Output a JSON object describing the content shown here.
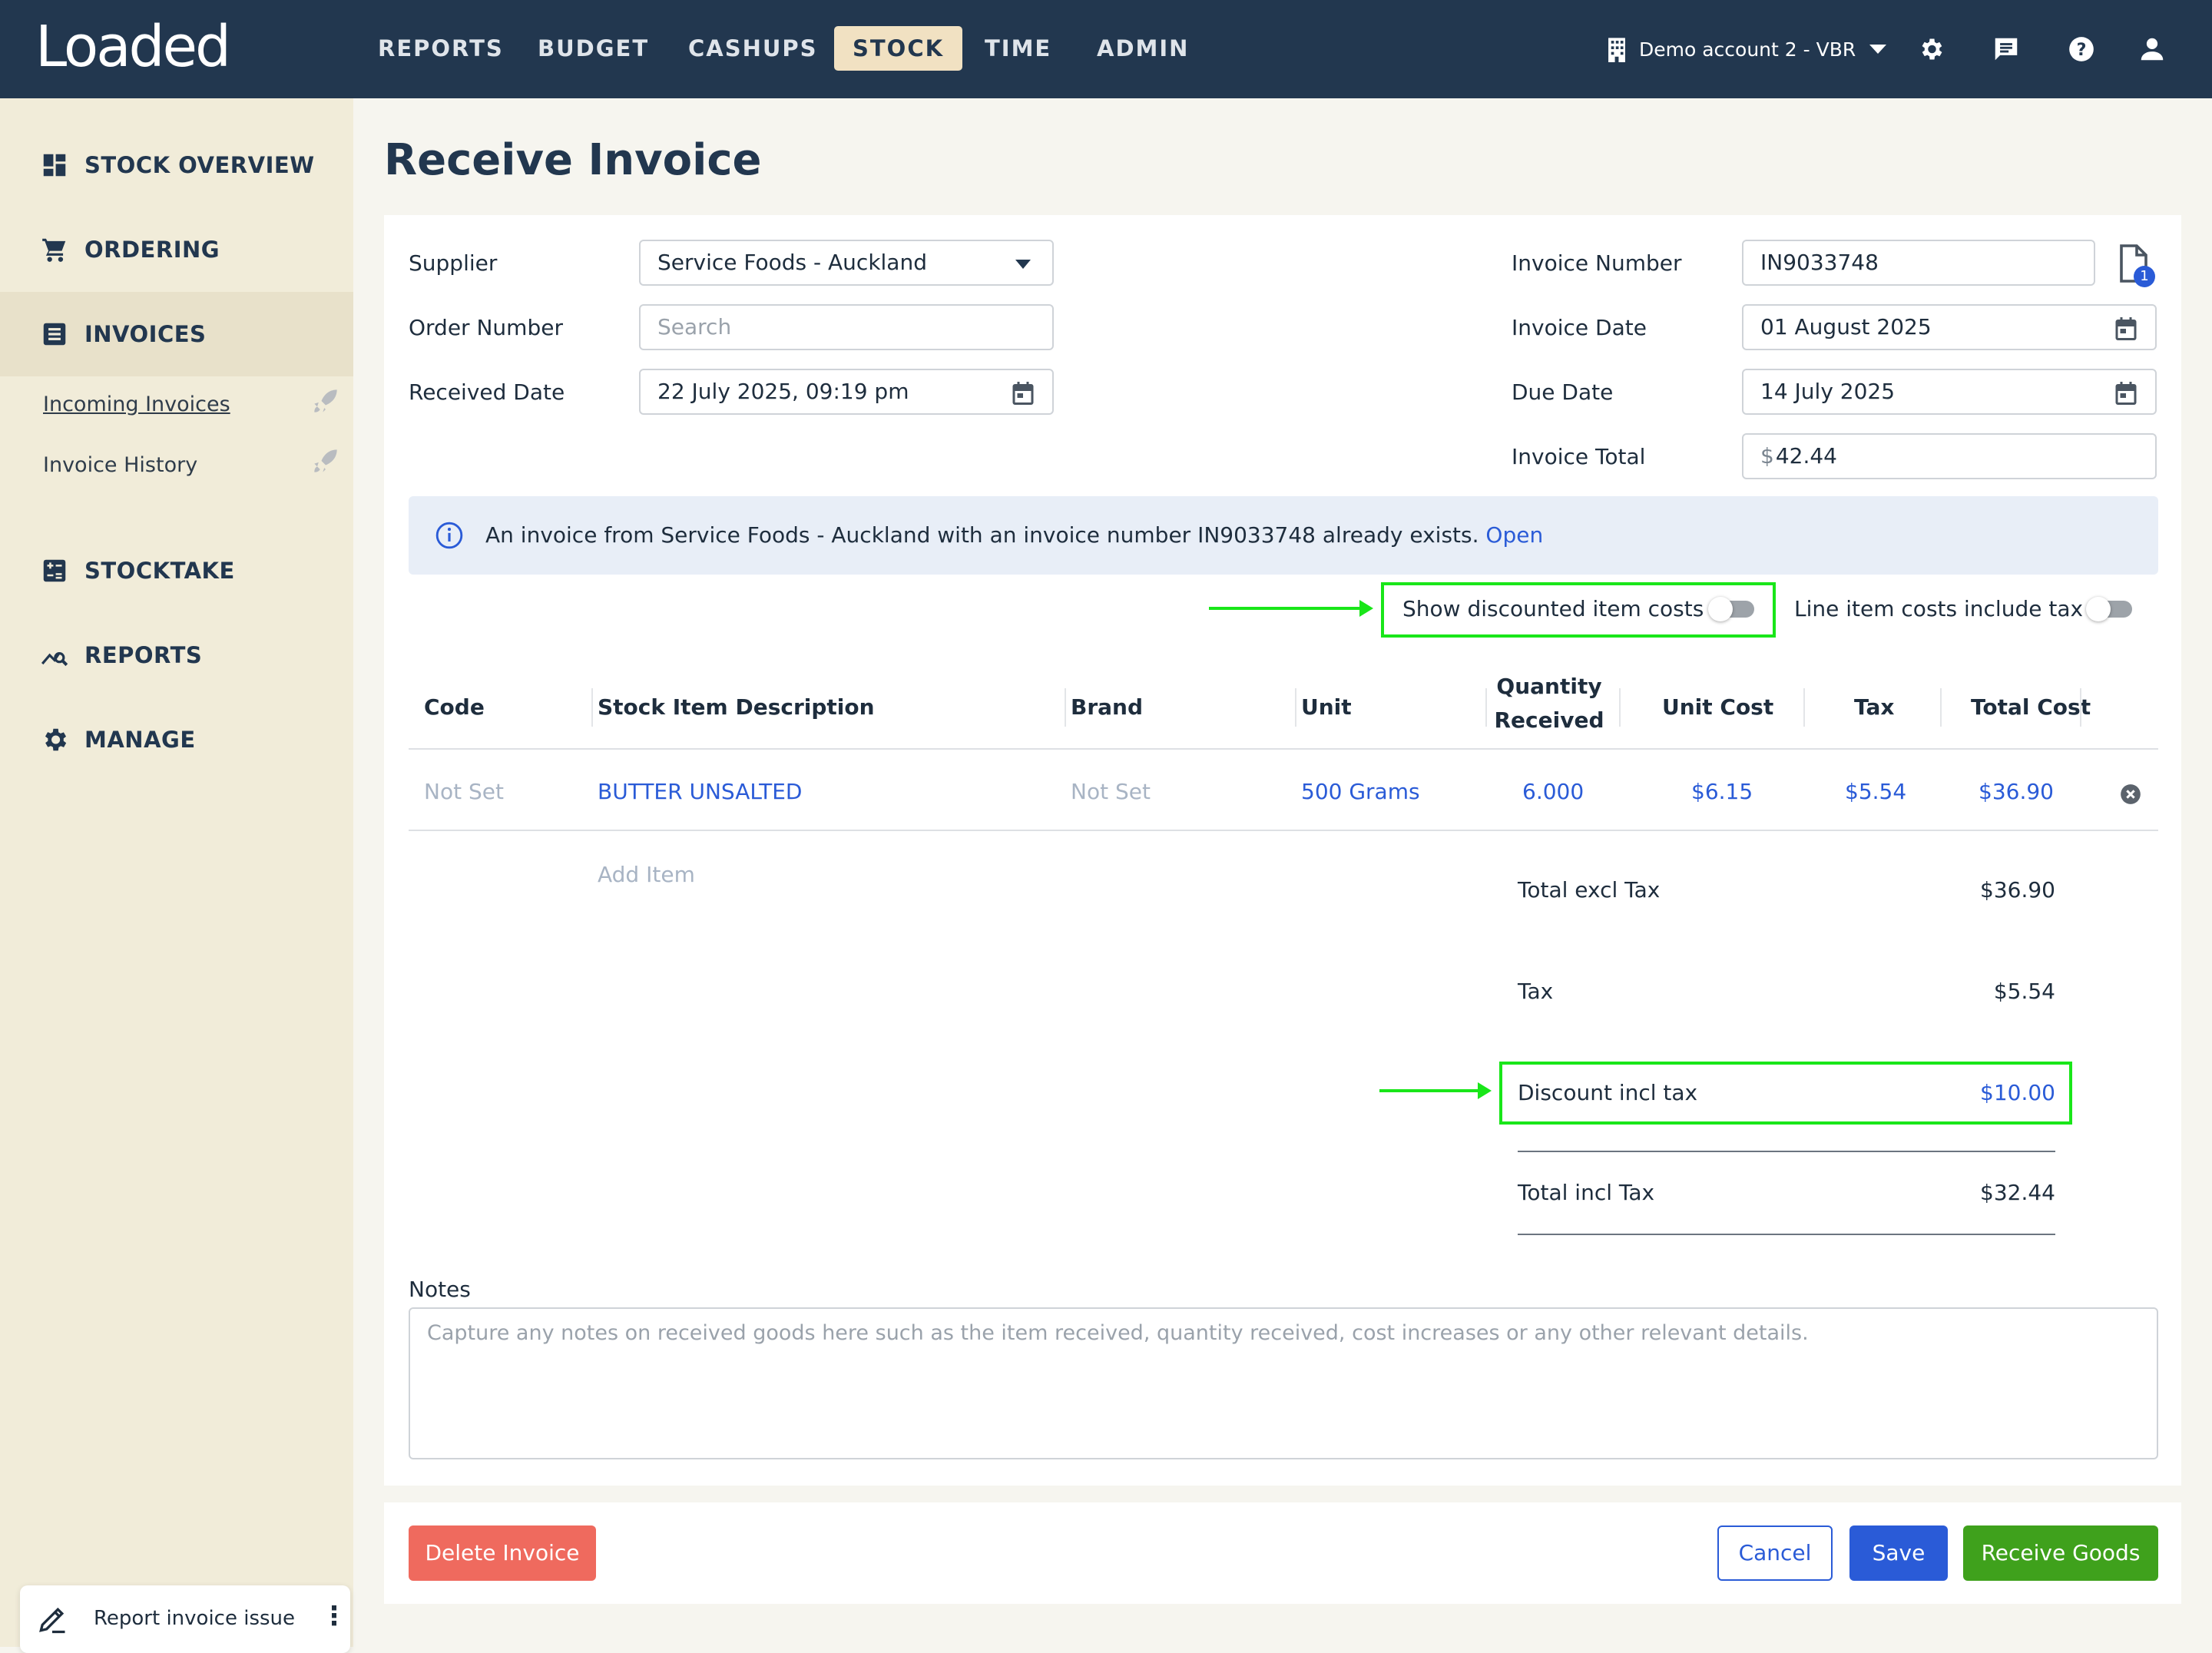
{
  "app": {
    "logo": "Loaded"
  },
  "topnav": {
    "items": [
      {
        "label": "REPORTS"
      },
      {
        "label": "BUDGET"
      },
      {
        "label": "CASHUPS"
      },
      {
        "label": "STOCK"
      },
      {
        "label": "TIME"
      },
      {
        "label": "ADMIN"
      }
    ],
    "active": "STOCK",
    "account": "Demo account 2 - VBR"
  },
  "sidebar": {
    "items": [
      {
        "label": "STOCK OVERVIEW",
        "icon": "dashboard-icon"
      },
      {
        "label": "ORDERING",
        "icon": "cart-icon"
      },
      {
        "label": "INVOICES",
        "icon": "invoice-list-icon"
      },
      {
        "label": "STOCKTAKE",
        "icon": "calculator-icon"
      },
      {
        "label": "REPORTS",
        "icon": "chart-search-icon"
      },
      {
        "label": "MANAGE",
        "icon": "gear-icon"
      }
    ],
    "subitems": [
      {
        "label": "Incoming Invoices"
      },
      {
        "label": "Invoice History"
      }
    ],
    "report_issue": "Report invoice issue"
  },
  "page": {
    "title": "Receive Invoice"
  },
  "form": {
    "supplier_label": "Supplier",
    "supplier_value": "Service Foods - Auckland",
    "order_number_label": "Order Number",
    "order_number_placeholder": "Search",
    "received_date_label": "Received Date",
    "received_date_value": "22 July 2025, 09:19 pm",
    "invoice_number_label": "Invoice Number",
    "invoice_number_value": "IN9033748",
    "attachment_count": "1",
    "invoice_date_label": "Invoice Date",
    "invoice_date_value": "01 August 2025",
    "due_date_label": "Due Date",
    "due_date_value": "14 July 2025",
    "invoice_total_label": "Invoice Total",
    "currency_symbol": "$",
    "invoice_total_value": "42.44"
  },
  "banner": {
    "text": "An invoice from Service Foods - Auckland with an invoice number IN9033748 already exists.",
    "link": "Open"
  },
  "toggles": {
    "show_discounted_label": "Show discounted item costs",
    "show_discounted_on": false,
    "include_tax_label": "Line item costs include tax",
    "include_tax_on": false
  },
  "table": {
    "headers": {
      "code": "Code",
      "description": "Stock Item Description",
      "brand": "Brand",
      "unit": "Unit",
      "qty_line1": "Quantity",
      "qty_line2": "Received",
      "unit_cost": "Unit Cost",
      "tax": "Tax",
      "total_cost": "Total Cost"
    },
    "rows": [
      {
        "code": "Not Set",
        "description": "BUTTER UNSALTED",
        "brand": "Not Set",
        "unit": "500 Grams",
        "qty": "6.000",
        "unit_cost": "$6.15",
        "tax": "$5.54",
        "total_cost": "$36.90"
      }
    ],
    "add_item": "Add Item"
  },
  "summary": {
    "total_excl_tax_label": "Total excl Tax",
    "total_excl_tax_value": "$36.90",
    "tax_label": "Tax",
    "tax_value": "$5.54",
    "discount_label": "Discount incl tax",
    "discount_value": "$10.00",
    "total_incl_tax_label": "Total incl Tax",
    "total_incl_tax_value": "$32.44"
  },
  "notes": {
    "label": "Notes",
    "placeholder": "Capture any notes on received goods here such as the item received, quantity received, cost increases or any other relevant details."
  },
  "buttons": {
    "delete": "Delete Invoice",
    "cancel": "Cancel",
    "save": "Save",
    "receive": "Receive Goods"
  },
  "colors": {
    "nav_bg": "#22374f",
    "active_tab": "#f1e1c2",
    "link_blue": "#2a5bd7",
    "highlight_green": "#19e619",
    "delete_red": "#ef6a5e",
    "receive_green": "#3fa11c"
  }
}
